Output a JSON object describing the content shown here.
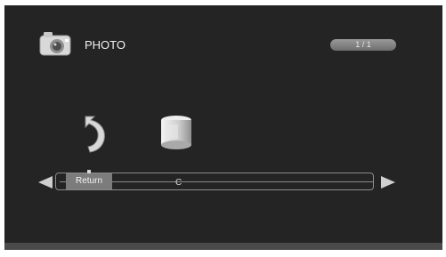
{
  "header": {
    "title": "PHOTO",
    "page_indicator": "1 / 1",
    "camera_icon": "camera-icon"
  },
  "browser": {
    "items": [
      {
        "icon": "return-arrow-icon",
        "label": "Return",
        "selected": true
      },
      {
        "icon": "drive-icon",
        "label": "C",
        "selected": false
      }
    ],
    "prev_icon": "arrow-left-icon",
    "next_icon": "arrow-right-icon"
  },
  "colors": {
    "background": "#242424",
    "text": "#f2f2f2",
    "selection": "#7c7c7c"
  }
}
